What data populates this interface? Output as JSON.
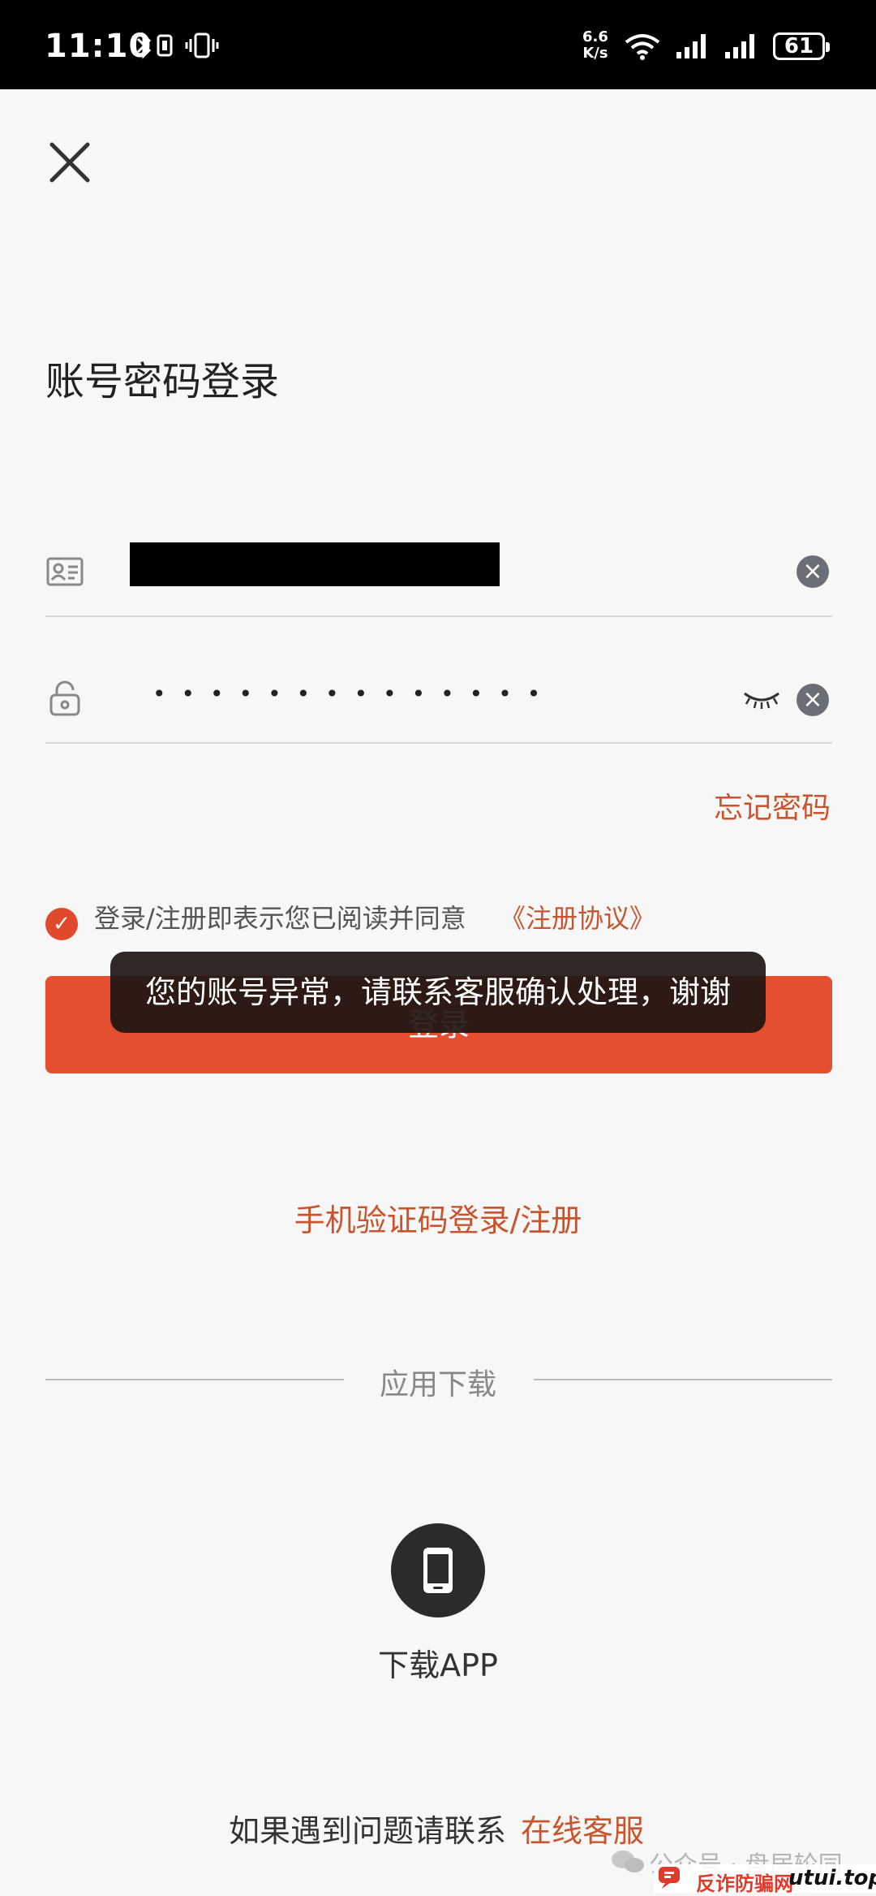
{
  "status_bar": {
    "time": "11:10",
    "net_speed_value": "6.6",
    "net_speed_unit": "K/s",
    "battery": "61",
    "icons": [
      "bluetooth-icon",
      "vibrate-icon",
      "wifi-icon",
      "signal-icon",
      "signal-icon",
      "battery-icon"
    ]
  },
  "page": {
    "title": "账号密码登录",
    "close_icon": "close-icon"
  },
  "form": {
    "account_icon": "id-card-icon",
    "password_icon": "lock-icon",
    "password_mask": "••••••••••••••",
    "clear_icon": "clear-icon",
    "eye_icon": "eye-closed-icon",
    "forgot_password": "忘记密码"
  },
  "agreement": {
    "checked": true,
    "text": "登录/注册即表示您已阅读并同意",
    "link": "《注册协议》"
  },
  "login_button": "登录",
  "toast": "您的账号异常，请联系客服确认处理，谢谢",
  "sms_login_link": "手机验证码登录/注册",
  "download": {
    "section_title": "应用下载",
    "app_label": "下载APP",
    "icon": "phone-icon"
  },
  "footer": {
    "help_text": "如果遇到问题请联系",
    "help_link": "在线客服"
  },
  "watermark": {
    "account": "公众号 · 盘居轮同",
    "site_name": "反诈防骗网",
    "domain": "utui.top"
  },
  "colors": {
    "accent": "#e4502f",
    "link": "#c9552e",
    "toast_bg": "#1e1614"
  }
}
